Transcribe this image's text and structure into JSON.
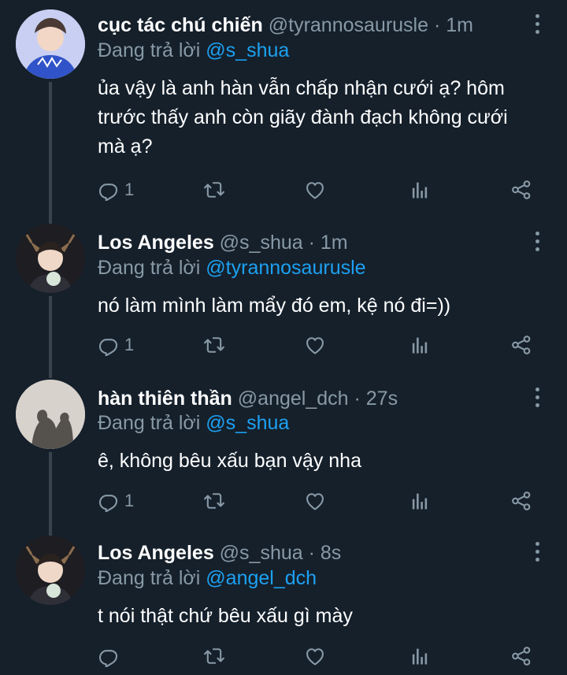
{
  "replying_label": "Đang trả lời",
  "tweets": [
    {
      "name": "cục tác chú chiến",
      "handle": "@tyrannosaurusle",
      "time": "1m",
      "reply_to": "@s_shua",
      "text": "ủa vậy là anh hàn vẫn chấp nhận cưới ạ? hôm trước thấy anh còn giãy đành đạch không cưới mà ạ?",
      "reply_count": "1"
    },
    {
      "name": "Los Angeles",
      "handle": "@s_shua",
      "time": "1m",
      "reply_to": "@tyrannosaurusle",
      "text": "nó làm mình làm mẩy đó em, kệ nó đi=))",
      "reply_count": "1"
    },
    {
      "name": "hàn thiên thần",
      "handle": "@angel_dch",
      "time": "27s",
      "reply_to": "@s_shua",
      "text": "ê, không bêu xấu bạn vậy nha",
      "reply_count": "1"
    },
    {
      "name": "Los Angeles",
      "handle": "@s_shua",
      "time": "8s",
      "reply_to": "@angel_dch",
      "text": "t nói thật chứ bêu xấu gì mày",
      "reply_count": ""
    }
  ],
  "icons": [
    "reply-icon",
    "retweet-icon",
    "like-icon",
    "analytics-icon",
    "share-icon",
    "more-icon"
  ],
  "colors": {
    "background": "#15202b",
    "secondary_text": "#8899a6",
    "mention": "#1da1f2",
    "thread_line": "#38444d"
  }
}
